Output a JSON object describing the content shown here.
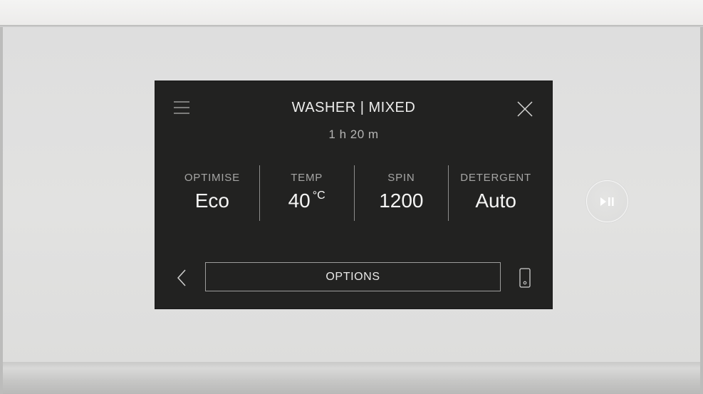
{
  "display": {
    "title": "WASHER | MIXED",
    "duration": "1 h 20 m",
    "settings": [
      {
        "label": "OPTIMISE",
        "value": "Eco",
        "unit": ""
      },
      {
        "label": "TEMP",
        "value": "40",
        "unit": "°C"
      },
      {
        "label": "SPIN",
        "value": "1200",
        "unit": ""
      },
      {
        "label": "DETERGENT",
        "value": "Auto",
        "unit": ""
      }
    ],
    "options_label": "OPTIONS"
  },
  "icons": {
    "menu": "menu-icon",
    "close": "close-icon",
    "back": "chevron-left-icon",
    "phone": "phone-icon",
    "play_pause": "play-pause-icon"
  },
  "colors": {
    "screen_background": "#222221",
    "screen_text": "#f1f1f0",
    "muted_text": "#a6a6a5",
    "appliance_panel": "#e2e2e1"
  }
}
